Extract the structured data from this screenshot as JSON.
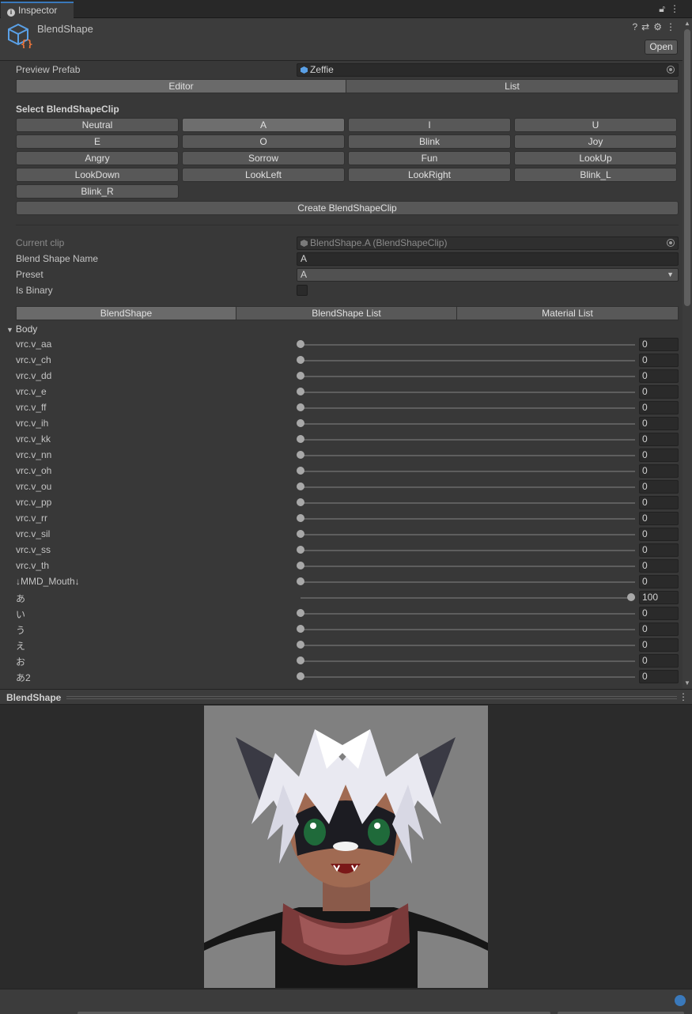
{
  "window": {
    "tab_label": "Inspector",
    "tab_icon": "info-icon",
    "toolbar_icons": [
      "lock-icon",
      "kebab-menu-icon"
    ]
  },
  "header": {
    "asset_name": "BlendShape",
    "asset_icon": "blendshape-clip-asset-icon",
    "icons": [
      "help-icon",
      "preset-sliders-icon",
      "gear-icon",
      "kebab-menu-icon"
    ],
    "open_label": "Open"
  },
  "preview_prefab": {
    "label": "Preview Prefab",
    "value": "Zeffie"
  },
  "mode_tabs": [
    {
      "label": "Editor",
      "selected": true
    },
    {
      "label": "List",
      "selected": false
    }
  ],
  "select_clip": {
    "title": "Select BlendShapeClip",
    "clips": [
      "Neutral",
      "A",
      "I",
      "U",
      "E",
      "O",
      "Blink",
      "Joy",
      "Angry",
      "Sorrow",
      "Fun",
      "LookUp",
      "LookDown",
      "LookLeft",
      "LookRight",
      "Blink_L",
      "Blink_R"
    ],
    "selected": "A",
    "create_label": "Create BlendShapeClip"
  },
  "clip_props": {
    "current_clip_label": "Current clip",
    "current_clip_value": "BlendShape.A (BlendShapeClip)",
    "name_label": "Blend Shape Name",
    "name_value": "A",
    "preset_label": "Preset",
    "preset_value": "A",
    "binary_label": "Is Binary",
    "binary_checked": false
  },
  "sub_tabs": [
    {
      "label": "BlendShape",
      "selected": true
    },
    {
      "label": "BlendShape List",
      "selected": false
    },
    {
      "label": "Material List",
      "selected": false
    }
  ],
  "body_group": {
    "label": "Body",
    "expanded": true,
    "shapes": [
      {
        "name": "vrc.v_aa",
        "value": 0
      },
      {
        "name": "vrc.v_ch",
        "value": 0
      },
      {
        "name": "vrc.v_dd",
        "value": 0
      },
      {
        "name": "vrc.v_e",
        "value": 0
      },
      {
        "name": "vrc.v_ff",
        "value": 0
      },
      {
        "name": "vrc.v_ih",
        "value": 0
      },
      {
        "name": "vrc.v_kk",
        "value": 0
      },
      {
        "name": "vrc.v_nn",
        "value": 0
      },
      {
        "name": "vrc.v_oh",
        "value": 0
      },
      {
        "name": "vrc.v_ou",
        "value": 0
      },
      {
        "name": "vrc.v_pp",
        "value": 0
      },
      {
        "name": "vrc.v_rr",
        "value": 0
      },
      {
        "name": "vrc.v_sil",
        "value": 0
      },
      {
        "name": "vrc.v_ss",
        "value": 0
      },
      {
        "name": "vrc.v_th",
        "value": 0
      },
      {
        "name": "↓MMD_Mouth↓",
        "value": 0
      },
      {
        "name": "あ",
        "value": 100
      },
      {
        "name": "い",
        "value": 0
      },
      {
        "name": "う",
        "value": 0
      },
      {
        "name": "え",
        "value": 0
      },
      {
        "name": "お",
        "value": 0
      },
      {
        "name": "あ2",
        "value": 0
      }
    ]
  },
  "preview": {
    "title": "BlendShape",
    "background": "#808080"
  },
  "colors": {
    "accent": "#3a79bb",
    "panel": "#383838",
    "button": "#585858"
  }
}
